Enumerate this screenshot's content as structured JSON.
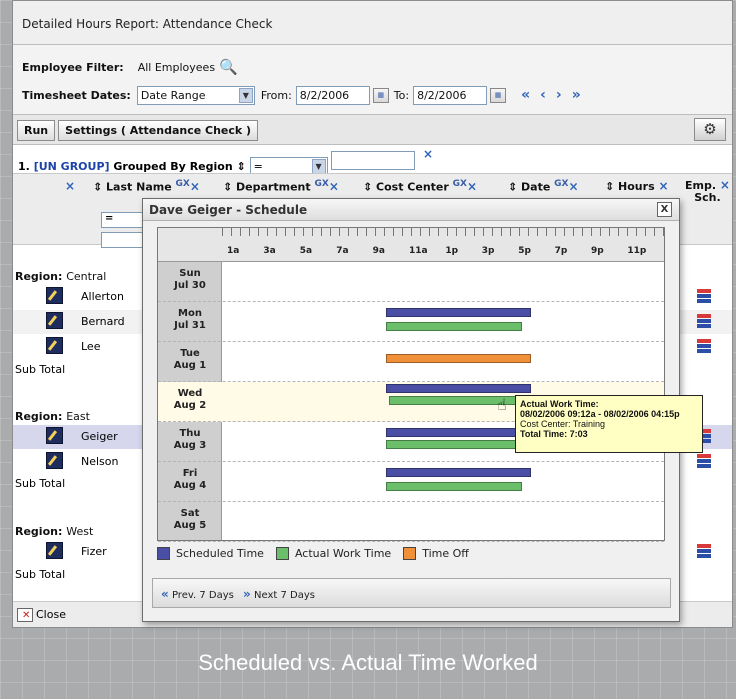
{
  "report": {
    "title": "Detailed Hours Report: Attendance Check"
  },
  "filters": {
    "employee_label": "Employee Filter:",
    "employee_value": "All Employees",
    "timesheet_label": "Timesheet Dates:",
    "range_value": "Date Range",
    "from_label": "From:",
    "from_value": "8/2/2006",
    "to_label": "To:",
    "to_value": "8/2/2006"
  },
  "toolbar": {
    "run_label": "Run",
    "settings_label": "Settings ( Attendance Check )"
  },
  "groupby": {
    "prefix": "1.",
    "ungroup_link": "[UN GROUP]",
    "grouped_by": "Grouped By",
    "field": "Region",
    "op_value": "="
  },
  "columns": {
    "last_name": "Last Name",
    "department": "Department",
    "cost_center": "Cost Center",
    "date": "Date",
    "hours": "Hours",
    "emp_sch_1": "Emp.",
    "emp_sch_2": "Sch.",
    "gx": "GX",
    "filter_op": "="
  },
  "regions": [
    {
      "label": "Region:",
      "name": "Central",
      "employees": [
        "Allerton",
        "Bernard",
        "Lee"
      ],
      "subtotal": "Sub Total"
    },
    {
      "label": "Region:",
      "name": "East",
      "employees": [
        "Geiger",
        "Nelson"
      ],
      "subtotal": "Sub Total"
    },
    {
      "label": "Region:",
      "name": "West",
      "employees": [
        "Fizer"
      ],
      "subtotal": "Sub Total"
    }
  ],
  "footer": {
    "close_label": "Close"
  },
  "modal": {
    "title": "Dave Geiger - Schedule",
    "hours": [
      "1a",
      "3a",
      "5a",
      "7a",
      "9a",
      "11a",
      "1p",
      "3p",
      "5p",
      "7p",
      "9p",
      "11p"
    ],
    "days": [
      {
        "dow": "Sun",
        "date": "Jul 30"
      },
      {
        "dow": "Mon",
        "date": "Jul 31"
      },
      {
        "dow": "Tue",
        "date": "Aug 1"
      },
      {
        "dow": "Wed",
        "date": "Aug 2"
      },
      {
        "dow": "Thu",
        "date": "Aug 3"
      },
      {
        "dow": "Fri",
        "date": "Aug 4"
      },
      {
        "dow": "Sat",
        "date": "Aug 5"
      }
    ],
    "tooltip": {
      "heading": "Actual Work Time:",
      "range": "08/02/2006 09:12a - 08/02/2006 04:15p",
      "cost_center": "Cost Center: Training",
      "total": "Total Time: 7:03"
    },
    "legend": {
      "scheduled": "Scheduled Time",
      "actual": "Actual Work Time",
      "timeoff": "Time Off"
    },
    "nav": {
      "prev": "Prev. 7 Days",
      "next": "Next 7 Days"
    }
  },
  "colors": {
    "scheduled": "#4a4fa5",
    "actual": "#6cbf6a",
    "timeoff": "#f0913a"
  },
  "caption": "Scheduled vs. Actual Time Worked"
}
